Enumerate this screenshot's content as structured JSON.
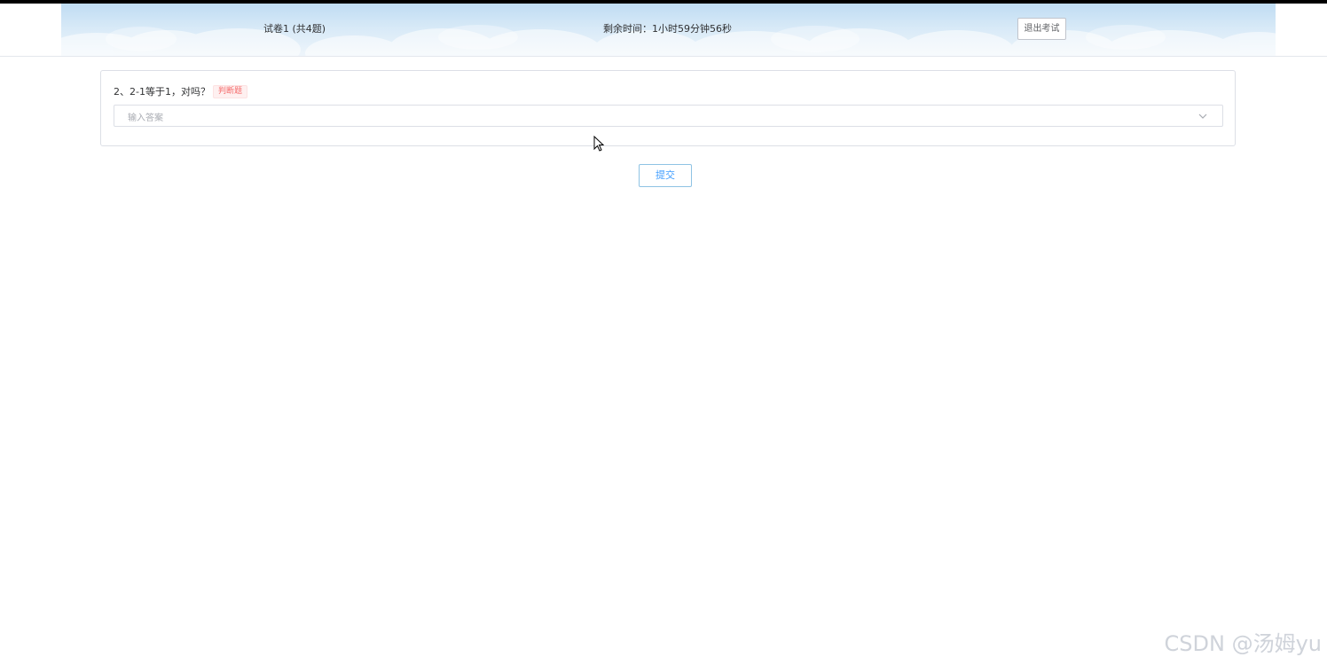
{
  "header": {
    "paper_title": "试卷1 (共4题)",
    "timer": "剩余时间：1小时59分钟56秒",
    "exit_label": "退出考试"
  },
  "question": {
    "text": "2、2-1等于1，对吗？",
    "tag": "判断题",
    "answer_placeholder": "输入答案"
  },
  "actions": {
    "submit_label": "提交"
  },
  "watermark": "CSDN @汤姆yu",
  "colors": {
    "header_sky": "#bfdcf3",
    "tag_red": "#f56c6c",
    "submit_blue": "#409eff"
  }
}
